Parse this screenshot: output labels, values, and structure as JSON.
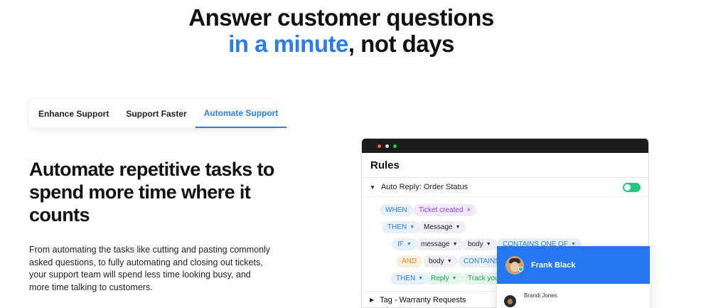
{
  "hero": {
    "line1": "Answer customer questions",
    "line2_accent": "in a minute",
    "line2_rest": ", not days"
  },
  "tabs": [
    {
      "label": "Enhance Support",
      "active": false
    },
    {
      "label": "Support Faster",
      "active": false
    },
    {
      "label": "Automate Support",
      "active": true
    }
  ],
  "headline": "Automate repetitive tasks to spend more time where it counts",
  "description": "From automating the tasks like cutting and pasting commonly asked questions, to fully automating and closing out tickets, your support team will spend less time looking busy, and more time talking to customers.",
  "rules_app": {
    "title": "Rules",
    "rule1": {
      "name": "Auto Reply: Order Status",
      "enabled": true
    },
    "chips": {
      "when": "WHEN",
      "ticket_created": "Ticket created",
      "then1": "THEN",
      "message_action": "Message",
      "if": "IF",
      "message_field": "message",
      "body1": "body",
      "contains_one_of": "CONTAINS ONE OF",
      "and": "AND",
      "body2": "body",
      "contains2": "CONTAINS",
      "then2": "THEN",
      "reply": "Reply",
      "track": "Track you"
    },
    "rule2": {
      "name": "Tag - Warranty Requests"
    }
  },
  "popup": {
    "agent_name": "Frank Black",
    "user_name": "Brandi Jones"
  },
  "colors": {
    "accent": "#2b7de9",
    "popup_header": "#2477ee",
    "toggle_on": "#2ec27e"
  }
}
